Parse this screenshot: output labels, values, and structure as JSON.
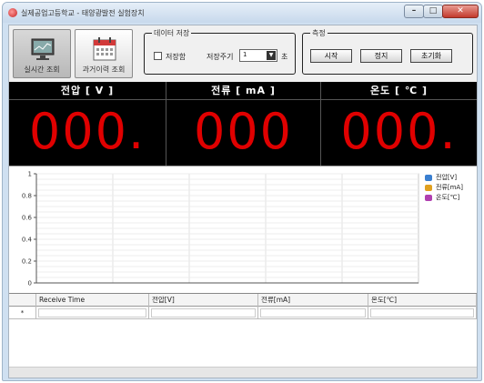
{
  "window": {
    "title": "실제공업고등학교 - 태양광발전 실험장치",
    "controls": [
      "minimize",
      "maximize",
      "close"
    ]
  },
  "toolbar": {
    "nav": [
      {
        "label": "실시간 조회",
        "icon": "monitor-icon"
      },
      {
        "label": "과거이력 조회",
        "icon": "calendar-icon"
      }
    ],
    "save_group": {
      "title": "데이터 저장",
      "save_checkbox_label": "저장함",
      "save_checked": false,
      "period_label": "저장주기",
      "period_value": "1",
      "unit": "초"
    },
    "measure_group": {
      "title": "측정",
      "start_label": "시작",
      "stop_label": "정지",
      "reset_label": "초기화"
    }
  },
  "readouts": [
    {
      "label": "전압 [ V ]",
      "value": "000."
    },
    {
      "label": "전류 [ mA ]",
      "value": "000"
    },
    {
      "label": "온도 [ ℃ ]",
      "value": "000."
    }
  ],
  "chart_data": {
    "type": "line",
    "x": [],
    "series": [
      {
        "name": "전압[V]",
        "values": [],
        "color": "#3a7fd0"
      },
      {
        "name": "전류[mA]",
        "values": [],
        "color": "#e0a020"
      },
      {
        "name": "온도[℃]",
        "values": [],
        "color": "#b040b0"
      }
    ],
    "ylim": [
      0,
      1
    ],
    "yticks": [
      "0",
      "0.2",
      "0.4",
      "0.6",
      "0.8",
      "1"
    ],
    "grid": true,
    "legend": "top-right"
  },
  "grid": {
    "columns": [
      "Receive Time",
      "전압[V]",
      "전류[mA]",
      "온도[℃]"
    ],
    "new_row_marker": "*"
  },
  "colors": {
    "readout_bg": "#000000",
    "readout_digit": "#e00000",
    "readout_header": "#ffffff"
  }
}
